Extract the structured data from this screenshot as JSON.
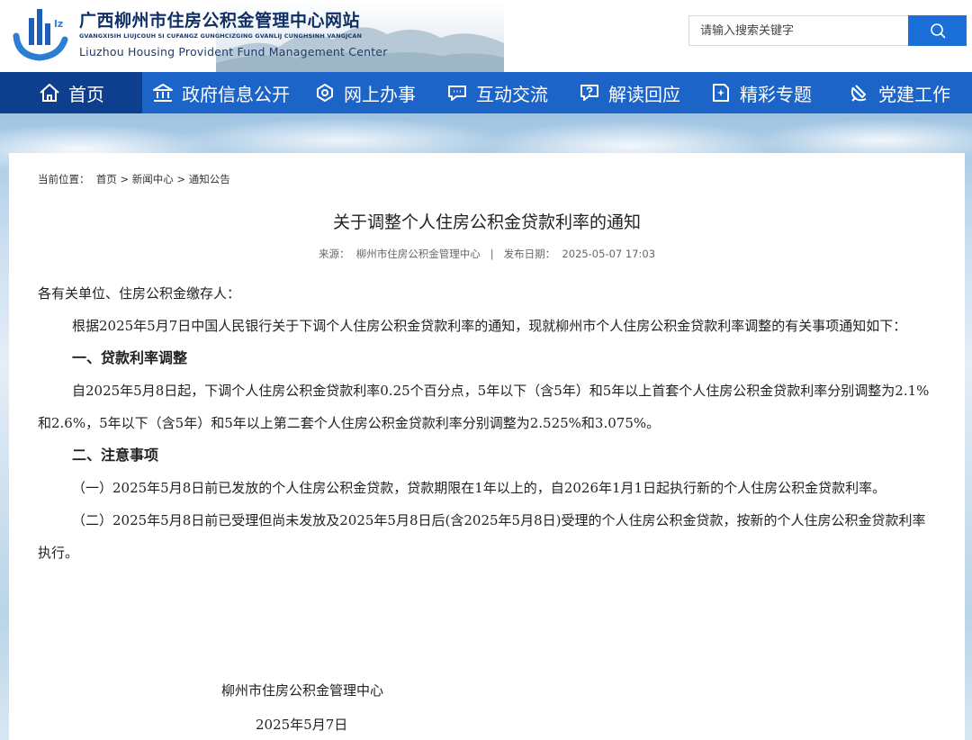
{
  "header": {
    "site_name": "广西柳州市住房公积金管理中心网站",
    "site_pinyin": "GVANGXISIH LIUJCOUH SI CUFANGZ GUNGHCIZGING GVANLIJ CUNGHSINH VANGJCAN",
    "site_en": "Liuzhou Housing Provident Fund Management Center",
    "search_placeholder": "请输入搜索关键字",
    "brand_color": "#1c64c8",
    "search_icon": "search-icon"
  },
  "nav": {
    "items": [
      {
        "label": "首页",
        "icon": "home-icon",
        "active": true
      },
      {
        "label": "政府信息公开",
        "icon": "government-building-icon"
      },
      {
        "label": "网上办事",
        "icon": "service-hub-icon"
      },
      {
        "label": "互动交流",
        "icon": "chat-bubble-icon"
      },
      {
        "label": "解读回应",
        "icon": "question-chat-icon"
      },
      {
        "label": "精彩专题",
        "icon": "sparkle-note-icon"
      },
      {
        "label": "党建工作",
        "icon": "party-emblem-icon"
      }
    ]
  },
  "breadcrumb": {
    "prefix": "当前位置：",
    "items": [
      "首页",
      "新闻中心",
      "通知公告"
    ],
    "separator": ">"
  },
  "article": {
    "title": "关于调整个人住房公积金贷款利率的通知",
    "source_label": "来源：",
    "source": "柳州市住房公积金管理中心",
    "meta_divider": "|",
    "date_label": "发布日期：",
    "date": "2025-05-07 17:03",
    "paragraphs": [
      "各有关单位、住房公积金缴存人：",
      "根据2025年5月7日中国人民银行关于下调个人住房公积金贷款利率的通知，现就柳州市个人住房公积金贷款利率调整的有关事项通知如下：",
      "一、贷款利率调整",
      "自2025年5月8日起，下调个人住房公积金贷款利率0.25个百分点，5年以下（含5年）和5年以上首套个人住房公积金贷款利率分别调整为2.1%和2.6%，5年以下（含5年）和5年以上第二套个人住房公积金贷款利率分别调整为2.525%和3.075%。",
      "二、注意事项",
      "（一）2025年5月8日前已发放的个人住房公积金贷款，贷款期限在1年以上的，自2026年1月1日起执行新的个人住房公积金贷款利率。",
      "（二）2025年5月8日前已受理但尚未发放及2025年5月8日后(含2025年5月8日)受理的个人住房公积金贷款，按新的个人住房公积金贷款利率执行。"
    ],
    "signature_org": "柳州市住房公积金管理中心",
    "signature_date": "2025年5月7日"
  }
}
